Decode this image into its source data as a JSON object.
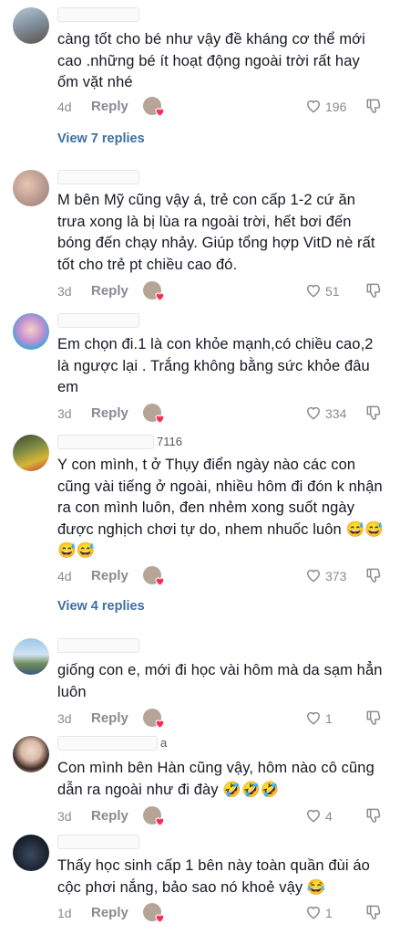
{
  "comments": [
    {
      "username": "",
      "username_tail": "",
      "text": "càng tốt cho bé như vậy đề kháng cơ thể mới cao .những bé ít hoạt động ngoài trời rất hay ốm vặt nhé",
      "time": "4d",
      "reply": "Reply",
      "likes": "196"
    },
    {
      "username": "",
      "username_tail": "",
      "text": "M bên Mỹ cũng vậy á, trẻ con cấp 1-2 cứ ăn trưa xong là bị lùa ra ngoài trời, hết bơi đến bóng đến chạy nhảy. Giúp tổng hợp VitD nè rất tốt cho trẻ pt chiều cao đó.",
      "time": "3d",
      "reply": "Reply",
      "likes": "51"
    },
    {
      "username": "",
      "username_tail": "",
      "text": "Em chọn đi.1 là con khỏe mạnh,có chiều cao,2 là ngược lại . Trắng không bằng sức khỏe đâu em",
      "time": "3d",
      "reply": "Reply",
      "likes": "334"
    },
    {
      "username": "",
      "username_tail": "7116",
      "text": "Y con mình, t ở Thụy điển ngày nào các con cũng vài tiếng ở ngoài, nhiều hôm đi đón k nhận ra con mình luôn, đen nhẻm xong suốt ngày được nghịch chơi tự do, nhem nhuốc luôn 😅😅😅😅",
      "time": "4d",
      "reply": "Reply",
      "likes": "373"
    },
    {
      "username": "",
      "username_tail": "",
      "text": "giống con e, mới đi học vài hôm mà da sạm hẳn luôn",
      "time": "3d",
      "reply": "Reply",
      "likes": "1"
    },
    {
      "username": "",
      "username_tail": "a",
      "text": "Con mình bên Hàn cũng vậy, hôm nào cô cũng dẫn ra ngoài như đi đày 🤣🤣🤣",
      "time": "3d",
      "reply": "Reply",
      "likes": "4"
    },
    {
      "username": "",
      "username_tail": "",
      "text": "Thấy học sinh cấp 1 bên này toàn quần đùi áo cộc phơi nắng, bảo sao nó khoẻ vậy 😂",
      "time": "1d",
      "reply": "Reply",
      "likes": "1"
    }
  ],
  "view_replies": [
    "View 7 replies",
    "View 4 replies"
  ],
  "colors": {
    "text": "#161823",
    "muted": "#8a8b91",
    "link": "#3d6fa3",
    "heart": "#fe2c55"
  },
  "icons": [
    "heart-outline-icon",
    "dislike-icon",
    "creator-liked-heart-icon"
  ]
}
